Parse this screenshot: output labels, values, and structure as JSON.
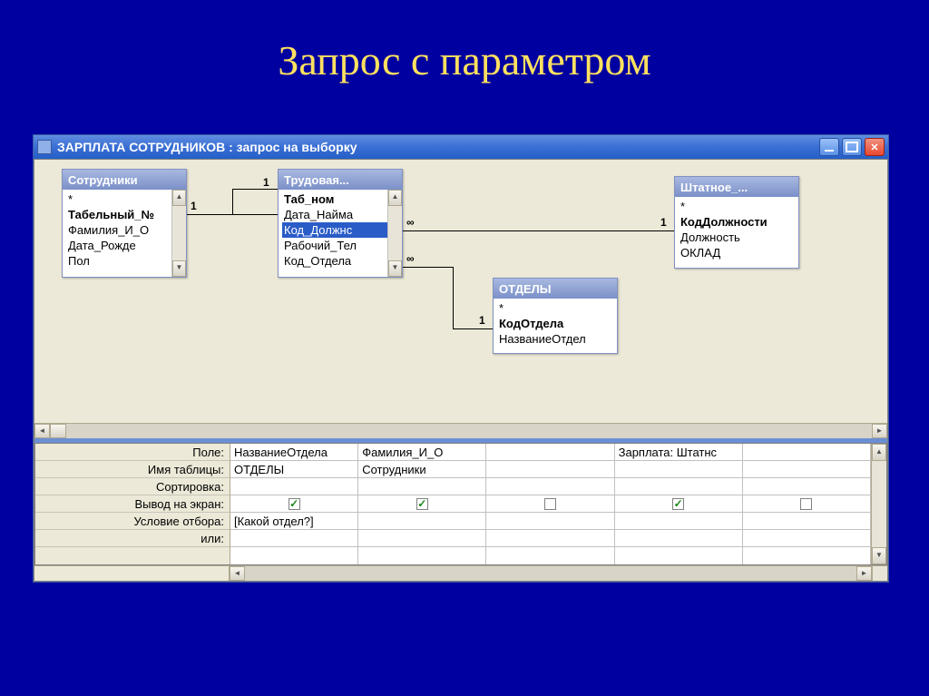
{
  "slide_title": "Запрос с параметром",
  "window": {
    "title": "ЗАРПЛАТА СОТРУДНИКОВ : запрос на выборку"
  },
  "tables": {
    "t1": {
      "title": "Сотрудники",
      "fields": [
        "*",
        "Табельный_№",
        "Фамилия_И_О",
        "Дата_Рожде",
        "Пол"
      ]
    },
    "t2": {
      "title": "Трудовая...",
      "fields": [
        "Таб_ном",
        "Дата_Найма",
        "Код_Должнс",
        "Рабочий_Тел",
        "Код_Отдела"
      ]
    },
    "t3": {
      "title": "ОТДЕЛЫ",
      "fields": [
        "*",
        "КодОтдела",
        "НазваниеОтдел"
      ]
    },
    "t4": {
      "title": "Штатное_...",
      "fields": [
        "*",
        "КодДолжности",
        "Должность",
        "ОКЛАД"
      ]
    }
  },
  "rel_labels": {
    "one_a": "1",
    "one_b": "1",
    "inf": "∞"
  },
  "grid": {
    "row_labels": [
      "Поле:",
      "Имя таблицы:",
      "Сортировка:",
      "Вывод на экран:",
      "Условие отбора:",
      "или:"
    ],
    "cols": [
      {
        "field": "НазваниеОтдела",
        "table": "ОТДЕЛЫ",
        "sort": "",
        "show": true,
        "criteria": "[Какой отдел?]",
        "or": ""
      },
      {
        "field": "Фамилия_И_О",
        "table": "Сотрудники",
        "sort": "",
        "show": true,
        "criteria": "",
        "or": ""
      },
      {
        "field": "",
        "table": "",
        "sort": "",
        "show": false,
        "criteria": "",
        "or": ""
      },
      {
        "field": "Зарплата: Штатнс",
        "table": "",
        "sort": "",
        "show": true,
        "criteria": "",
        "or": ""
      },
      {
        "field": "",
        "table": "",
        "sort": "",
        "show": false,
        "criteria": "",
        "or": ""
      }
    ]
  }
}
